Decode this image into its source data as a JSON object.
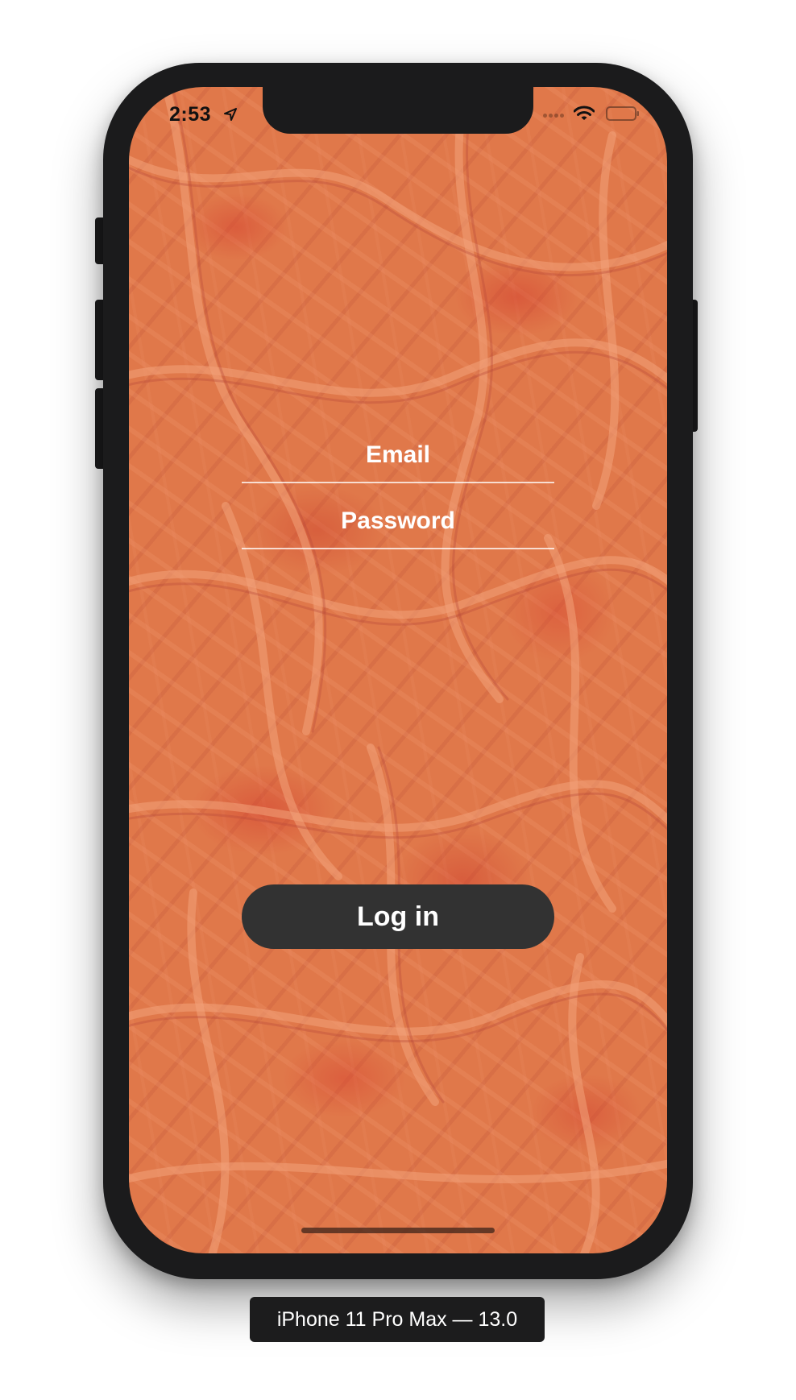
{
  "status_bar": {
    "time": "2:53",
    "location_icon": "location-arrow-icon",
    "wifi_icon": "wifi-icon",
    "battery_icon": "battery-icon"
  },
  "login_form": {
    "email_placeholder": "Email",
    "password_placeholder": "Password",
    "login_label": "Log in"
  },
  "simulator": {
    "device_label": "iPhone 11 Pro Max — 13.0"
  },
  "colors": {
    "background": "#e0784a",
    "button": "#323232",
    "text": "#ffffff",
    "device_frame": "#1b1b1c"
  }
}
